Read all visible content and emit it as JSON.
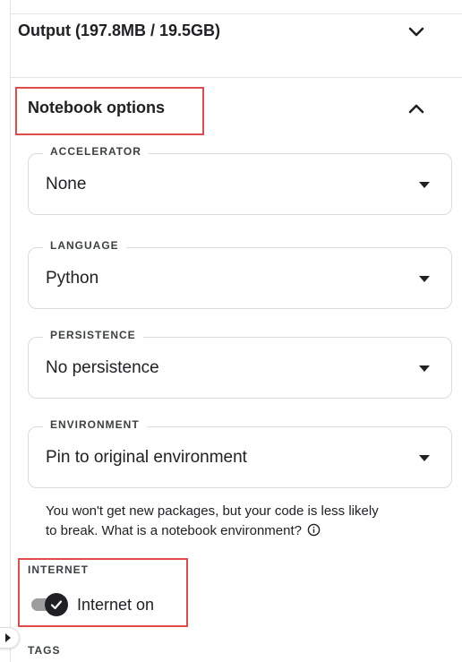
{
  "output": {
    "title": "Output (197.8MB / 19.5GB)",
    "icon": "chevron-down-icon"
  },
  "notebook_options": {
    "title": "Notebook options",
    "icon": "chevron-up-icon",
    "accelerator": {
      "label": "ACCELERATOR",
      "value": "None"
    },
    "language": {
      "label": "LANGUAGE",
      "value": "Python"
    },
    "persistence": {
      "label": "PERSISTENCE",
      "value": "No persistence"
    },
    "environment": {
      "label": "ENVIRONMENT",
      "value": "Pin to original environment",
      "helper_line1": "You won't get new packages, but your code is less likely",
      "helper_line2": "to break. What is a notebook environment?"
    },
    "internet": {
      "heading": "INTERNET",
      "toggle_label": "Internet on",
      "enabled": true
    },
    "tags": {
      "heading": "TAGS"
    }
  },
  "colors": {
    "highlight": "#e34a4a",
    "text": "#202124",
    "border": "#dadce0",
    "toggle_track": "#9e9e9e"
  }
}
